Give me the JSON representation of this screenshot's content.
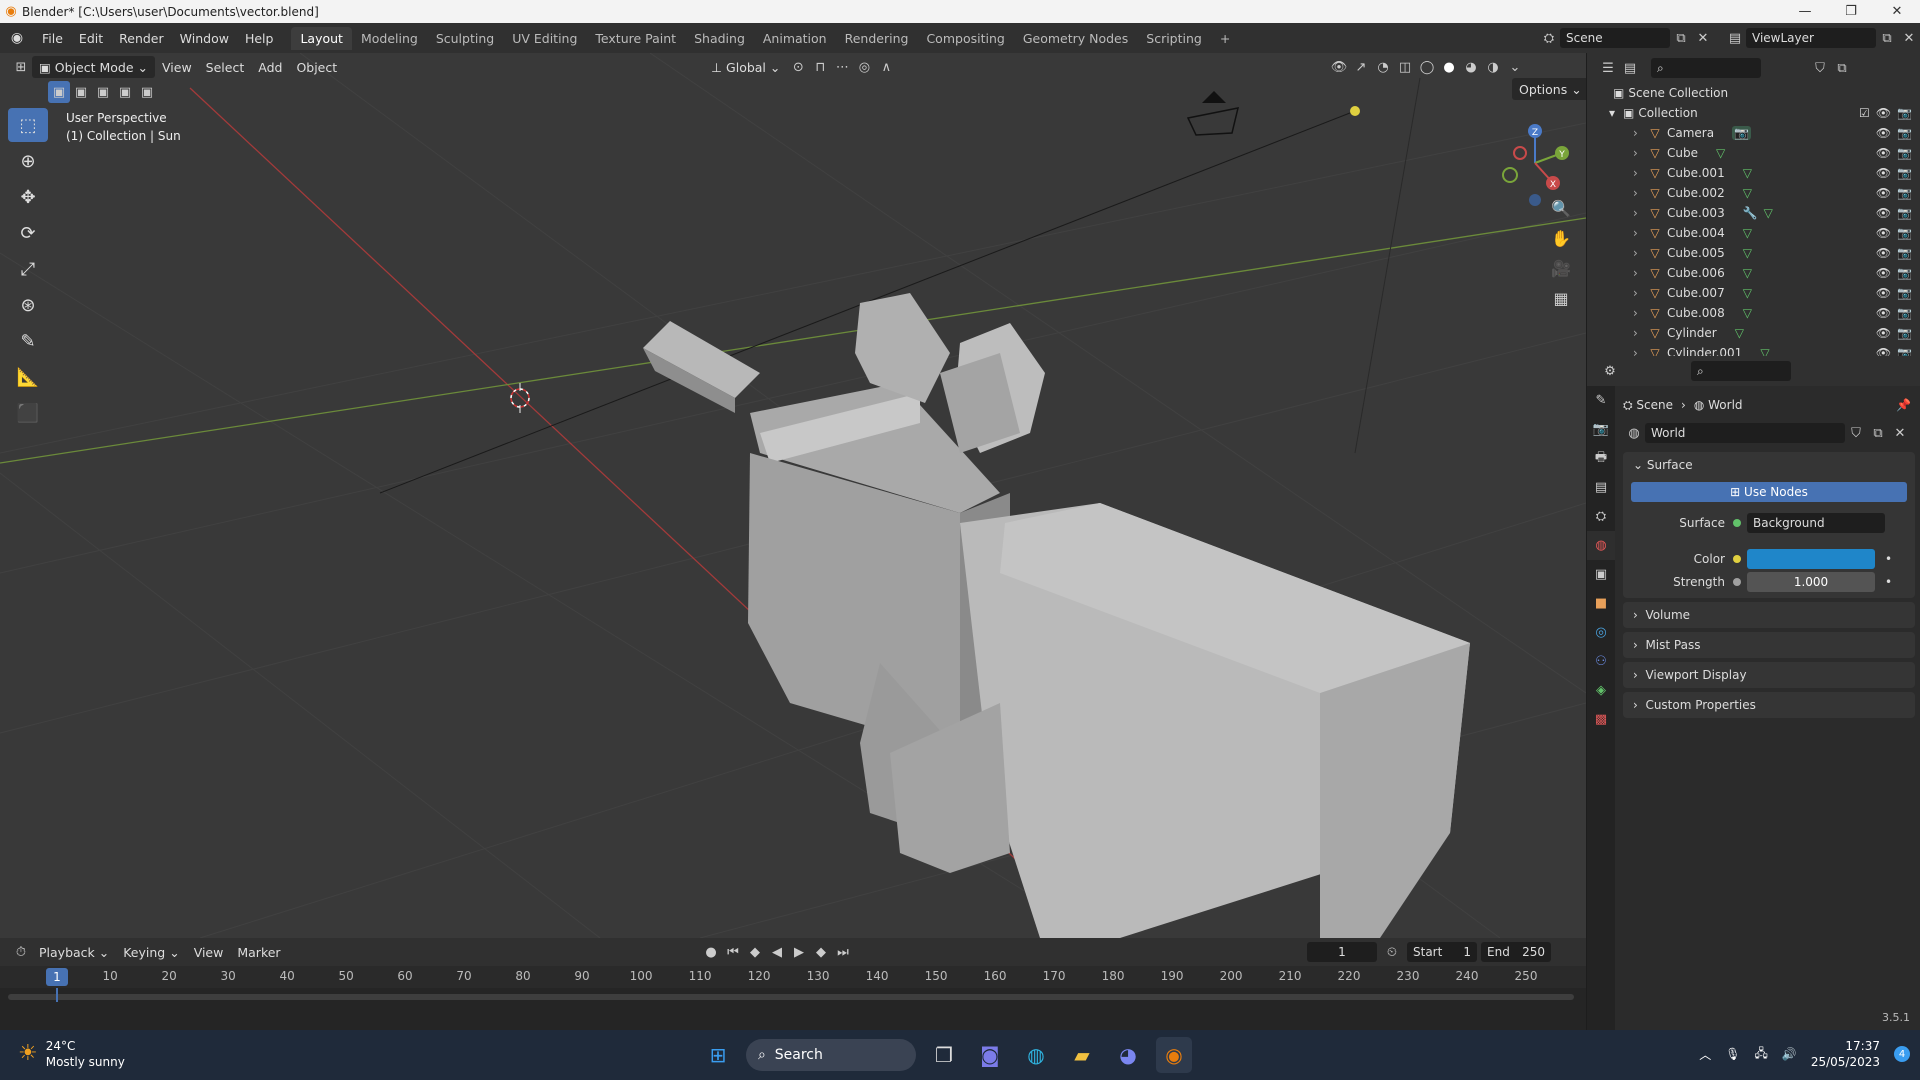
{
  "window": {
    "title": "Blender* [C:\\Users\\user\\Documents\\vector.blend]"
  },
  "menu": [
    "File",
    "Edit",
    "Render",
    "Window",
    "Help"
  ],
  "workspaces": [
    "Layout",
    "Modeling",
    "Sculpting",
    "UV Editing",
    "Texture Paint",
    "Shading",
    "Animation",
    "Rendering",
    "Compositing",
    "Geometry Nodes",
    "Scripting",
    "+"
  ],
  "active_workspace": "Layout",
  "scene_name": "Scene",
  "view_layer": "ViewLayer",
  "viewport": {
    "mode": "Object Mode",
    "menus": [
      "View",
      "Select",
      "Add",
      "Object"
    ],
    "transform_orientation": "Global",
    "options_label": "Options",
    "info_line1": "User Perspective",
    "info_line2": "(1) Collection | Sun",
    "gizmo_axes": {
      "x": "X",
      "y": "Y",
      "z": "Z"
    }
  },
  "timeline": {
    "menus": [
      "Playback",
      "Keying",
      "View",
      "Marker"
    ],
    "current_frame": "1",
    "start_label": "Start",
    "start": "1",
    "end_label": "End",
    "end": "250",
    "ruler": [
      "1",
      "10",
      "20",
      "30",
      "40",
      "50",
      "60",
      "70",
      "80",
      "90",
      "100",
      "110",
      "120",
      "130",
      "140",
      "150",
      "160",
      "170",
      "180",
      "190",
      "200",
      "210",
      "220",
      "230",
      "240",
      "250"
    ]
  },
  "outliner": {
    "root": "Scene Collection",
    "collection": "Collection",
    "items": [
      {
        "name": "Camera",
        "type": "camera"
      },
      {
        "name": "Cube",
        "type": "mesh"
      },
      {
        "name": "Cube.001",
        "type": "mesh"
      },
      {
        "name": "Cube.002",
        "type": "mesh"
      },
      {
        "name": "Cube.003",
        "type": "mesh-mod"
      },
      {
        "name": "Cube.004",
        "type": "mesh"
      },
      {
        "name": "Cube.005",
        "type": "mesh"
      },
      {
        "name": "Cube.006",
        "type": "mesh"
      },
      {
        "name": "Cube.007",
        "type": "mesh"
      },
      {
        "name": "Cube.008",
        "type": "mesh"
      },
      {
        "name": "Cylinder",
        "type": "mesh"
      },
      {
        "name": "Cylinder.001",
        "type": "mesh"
      }
    ]
  },
  "properties": {
    "breadcrumb_scene": "Scene",
    "breadcrumb_world": "World",
    "world_name": "World",
    "surface_panel": "Surface",
    "use_nodes": "Use Nodes",
    "surface_label": "Surface",
    "surface_value": "Background",
    "color_label": "Color",
    "color_value": "#1f86c9",
    "strength_label": "Strength",
    "strength_value": "1.000",
    "panels": [
      "Volume",
      "Mist Pass",
      "Viewport Display",
      "Custom Properties"
    ]
  },
  "version": "3.5.1",
  "taskbar": {
    "weather_temp": "24°C",
    "weather_desc": "Mostly sunny",
    "search": "Search",
    "time": "17:37",
    "date": "25/05/2023",
    "notif_count": "4"
  },
  "colors": {
    "accent": "#4772b3",
    "mesh_icon": "#62c26a",
    "object_icon": "#e8a05a"
  }
}
